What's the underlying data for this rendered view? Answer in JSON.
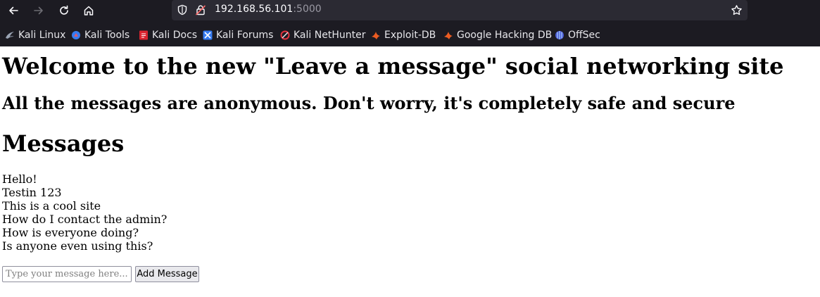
{
  "browser": {
    "url_host": "192.168.56.101",
    "url_port": ":5000",
    "bookmarks": [
      {
        "label": "Kali Linux",
        "icon": "kali-dragon-icon",
        "color": "#5a8bd6"
      },
      {
        "label": "Kali Tools",
        "icon": "kali-tools-icon",
        "color": "#367bf0"
      },
      {
        "label": "Kali Docs",
        "icon": "kali-docs-icon",
        "color": "#d9232f"
      },
      {
        "label": "Kali Forums",
        "icon": "kali-forums-icon",
        "color": "#367bf0"
      },
      {
        "label": "Kali NetHunter",
        "icon": "nethunter-icon",
        "color": "#e0313d"
      },
      {
        "label": "Exploit-DB",
        "icon": "exploit-db-icon",
        "color": "#ec5c22"
      },
      {
        "label": "Google Hacking DB",
        "icon": "ghdb-icon",
        "color": "#ec5c22"
      },
      {
        "label": "OffSec",
        "icon": "offsec-icon",
        "color": "#6b7cf5"
      }
    ]
  },
  "page": {
    "title": "Welcome to the new \"Leave a message\" social networking site",
    "subtitle": "All the messages are anonymous. Don't worry, it's completely safe and secure",
    "messages_heading": "Messages",
    "messages": [
      "Hello!",
      "Testin 123",
      "This is a cool site",
      "How do I contact the admin?",
      "How is everyone doing?",
      "Is anyone even using this?"
    ],
    "input_placeholder": "Type your message here...",
    "add_button_label": "Add Message"
  }
}
